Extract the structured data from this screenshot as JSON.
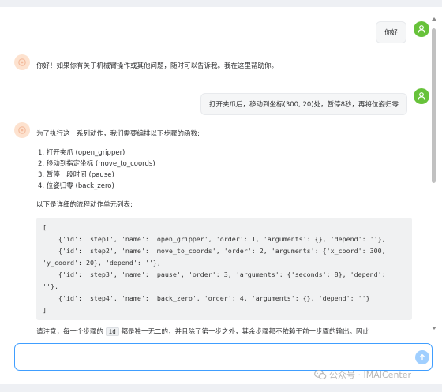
{
  "conversation": {
    "user1": "你好",
    "bot1": "你好！如果你有关于机械臂操作或其他问题，随时可以告诉我。我在这里帮助你。",
    "user2": "打开夹爪后，移动到坐标(300, 20)处，暂停8秒，再将位姿归零",
    "bot2": {
      "intro": "为了执行这一系列动作，我们需要编排以下步骤的函数:",
      "steps": [
        "1. 打开夹爪 (open_gripper)",
        "2. 移动到指定坐标 (move_to_coords)",
        "3. 暂停一段时间 (pause)",
        "4. 位姿归零 (back_zero)"
      ],
      "list_intro": "以下是详细的流程动作单元列表:",
      "code_lines": [
        "[",
        "    {'id': 'step1', 'name': 'open_gripper', 'order': 1, 'arguments': {}, 'depend': ''},",
        "    {'id': 'step2', 'name': 'move_to_coords', 'order': 2, 'arguments': {'x_coord': 300,",
        "'y_coord': 20}, 'depend': ''},",
        "    {'id': 'step3', 'name': 'pause', 'order': 3, 'arguments': {'seconds': 8}, 'depend':",
        "''},",
        "    {'id': 'step4', 'name': 'back_zero', 'order': 4, 'arguments': {}, 'depend': ''}",
        "]"
      ],
      "note_before": "请注意，每一个步骤的",
      "note_code": "id",
      "note_after": "都是独一无二的，并且除了第一步之外，其余步骤都不依赖于前一步骤的输出。因此"
    }
  },
  "input": {
    "placeholder": ""
  },
  "watermark": "公众号 · IMAICenter",
  "colors": {
    "accent": "#409eff",
    "user_avatar": "#67c23a",
    "bot_avatar": "#fde2cf"
  }
}
